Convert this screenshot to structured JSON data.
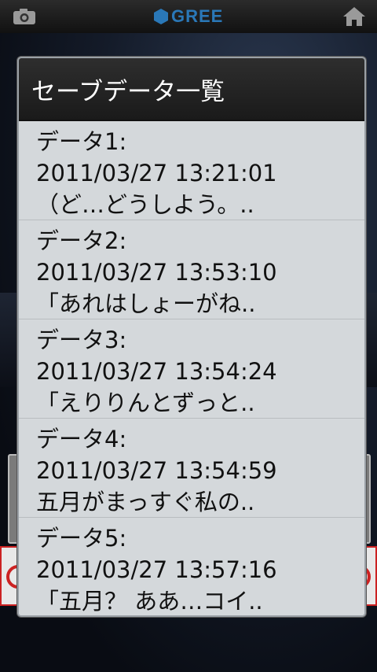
{
  "header_bar": {
    "brand": "GREE",
    "left_icon": "camera-icon",
    "right_icon": "home-icon"
  },
  "dialog": {
    "title": "セーブデータ一覧",
    "items": [
      {
        "slot": "データ1:",
        "datetime": "2011/03/27 13:21:01",
        "preview": "（ど…どうしよう。.."
      },
      {
        "slot": "データ2:",
        "datetime": "2011/03/27 13:53:10",
        "preview": "「あれはしょーがね.."
      },
      {
        "slot": "データ3:",
        "datetime": "2011/03/27 13:54:24",
        "preview": "「えりりんとずっと.."
      },
      {
        "slot": "データ4:",
        "datetime": "2011/03/27 13:54:59",
        "preview": "五月がまっすぐ私の.."
      },
      {
        "slot": "データ5:",
        "datetime": "2011/03/27 13:57:16",
        "preview": "「五月？ ああ…コイ.."
      }
    ]
  },
  "colors": {
    "brand": "#2a78b8",
    "dialog_bg": "#d4d8db",
    "header_bg": "#1a1a1a"
  }
}
